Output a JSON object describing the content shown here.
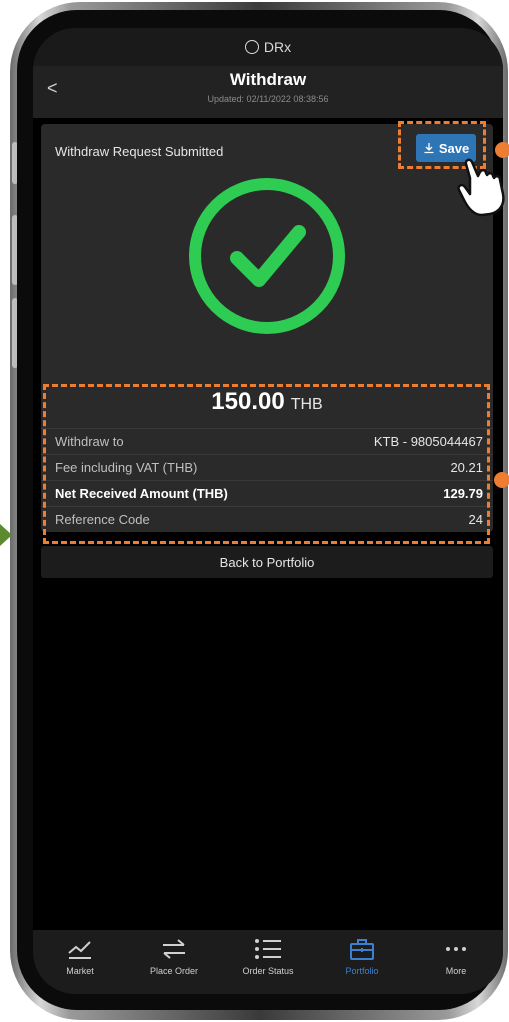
{
  "status_bar": {
    "app_name": "DRx"
  },
  "header": {
    "back_icon": "chevron-left-icon",
    "title": "Withdraw",
    "updated": "Updated: 02/11/2022 08:38:56"
  },
  "result": {
    "title": "Withdraw Request Submitted",
    "save_label": "Save",
    "save_icon": "download-icon",
    "status_icon": "success-check-icon",
    "amount": "150.00",
    "currency": "THB"
  },
  "details": [
    {
      "label": "Withdraw to",
      "value": "KTB - 9805044467",
      "bold": false
    },
    {
      "label": "Fee including VAT (THB)",
      "value": "20.21",
      "bold": false
    },
    {
      "label": "Net Received Amount (THB)",
      "value": "129.79",
      "bold": true
    },
    {
      "label": "Reference Code",
      "value": "24",
      "bold": false
    }
  ],
  "back_button": "Back to Portfolio",
  "tabs": [
    {
      "label": "Market",
      "icon": "chart-icon",
      "active": false
    },
    {
      "label": "Place Order",
      "icon": "swap-arrows-icon",
      "active": false
    },
    {
      "label": "Order Status",
      "icon": "list-icon",
      "active": false
    },
    {
      "label": "Portfolio",
      "icon": "briefcase-icon",
      "active": true
    },
    {
      "label": "More",
      "icon": "more-dots-icon",
      "active": false
    }
  ],
  "colors": {
    "accent": "#2e75b6",
    "success": "#2ecc52",
    "annotation": "#ec7d31",
    "active_tab": "#3d7fd1"
  }
}
